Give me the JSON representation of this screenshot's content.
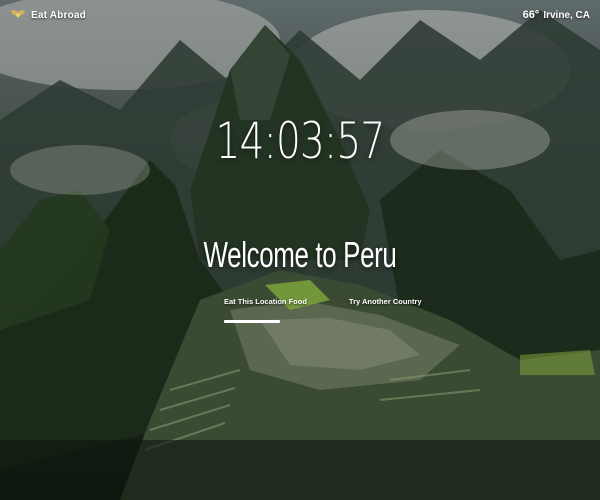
{
  "brand": {
    "name": "Eat Abroad",
    "icon": "winged-logo-icon"
  },
  "weather": {
    "temperature": "66°",
    "location": "Irvine, CA"
  },
  "clock": {
    "time": "14:03:57"
  },
  "main": {
    "welcome": "Welcome to Peru"
  },
  "actions": {
    "eat_label": "Eat This Location Food",
    "try_label": "Try Another Country"
  },
  "colors": {
    "text": "#ffffff",
    "accent_gold": "#d6b15a"
  }
}
